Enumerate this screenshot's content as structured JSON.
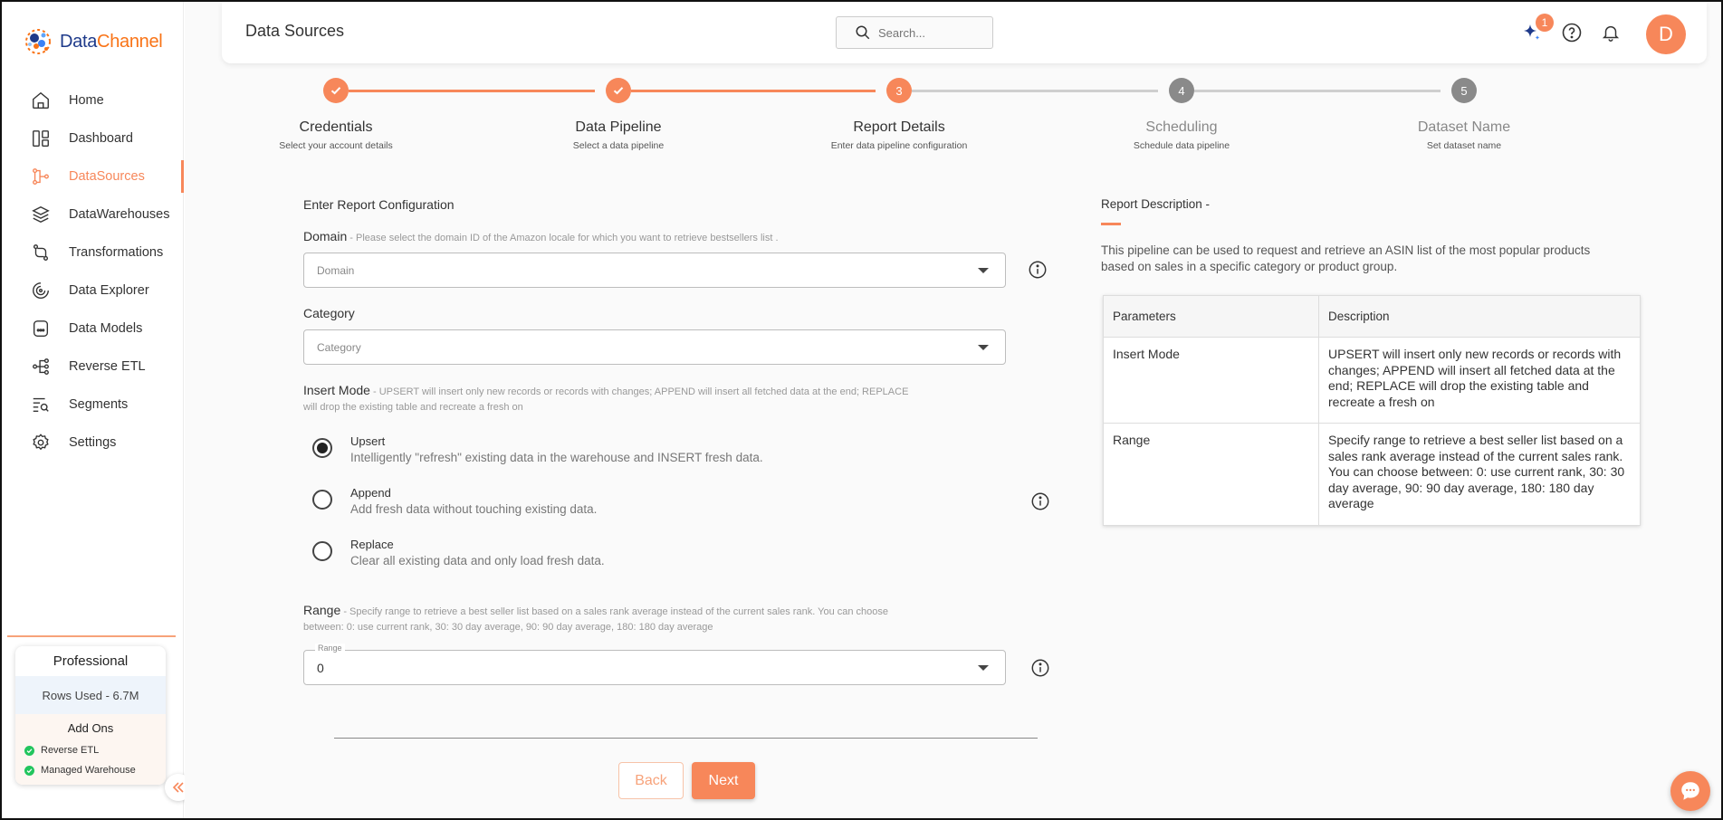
{
  "brand": {
    "name_part1": "Data",
    "name_part2": "Channel"
  },
  "sidebar": {
    "items": [
      {
        "label": "Home",
        "icon": "home-icon",
        "active": false
      },
      {
        "label": "Dashboard",
        "icon": "dashboard-icon",
        "active": false
      },
      {
        "label": "DataSources",
        "icon": "datasources-icon",
        "active": true
      },
      {
        "label": "DataWarehouses",
        "icon": "datawarehouses-icon",
        "active": false
      },
      {
        "label": "Transformations",
        "icon": "transformations-icon",
        "active": false
      },
      {
        "label": "Data Explorer",
        "icon": "data-explorer-icon",
        "active": false
      },
      {
        "label": "Data Models",
        "icon": "data-models-icon",
        "active": false
      },
      {
        "label": "Reverse ETL",
        "icon": "reverse-etl-icon",
        "active": false
      },
      {
        "label": "Segments",
        "icon": "segments-icon",
        "active": false
      },
      {
        "label": "Settings",
        "icon": "settings-icon",
        "active": false
      }
    ],
    "plan": {
      "name": "Professional",
      "rows_used": "Rows Used - 6.7M",
      "addons_title": "Add Ons",
      "addons": [
        "Reverse ETL",
        "Managed Warehouse"
      ]
    },
    "collapse_icon": "double-chevron-left-icon"
  },
  "header": {
    "title": "Data Sources",
    "search_placeholder": "Search...",
    "notification_badge": "1",
    "avatar_letter": "D"
  },
  "stepper": {
    "steps": [
      {
        "title": "Credentials",
        "subtitle": "Select your account details",
        "status": "done",
        "marker": ""
      },
      {
        "title": "Data Pipeline",
        "subtitle": "Select a data pipeline",
        "status": "done",
        "marker": ""
      },
      {
        "title": "Report Details",
        "subtitle": "Enter data pipeline configuration",
        "status": "current",
        "marker": "3"
      },
      {
        "title": "Scheduling",
        "subtitle": "Schedule data pipeline",
        "status": "todo",
        "marker": "4"
      },
      {
        "title": "Dataset Name",
        "subtitle": "Set dataset name",
        "status": "todo",
        "marker": "5"
      }
    ]
  },
  "form": {
    "heading": "Enter Report Configuration",
    "domain": {
      "label": "Domain",
      "help": " - Please select the domain ID of the Amazon locale for which you want to retrieve bestsellers list .",
      "placeholder": "Domain"
    },
    "category": {
      "label": "Category",
      "placeholder": "Category"
    },
    "insert_mode": {
      "label": "Insert Mode",
      "help_line1": " - UPSERT will insert only new records or records with changes; APPEND will insert all fetched data at the end; REPLACE",
      "help_line2": "will drop the existing table and recreate a fresh on",
      "selected": "Upsert",
      "options": [
        {
          "title": "Upsert",
          "desc": "Intelligently \"refresh\" existing data in the warehouse and INSERT fresh data."
        },
        {
          "title": "Append",
          "desc": "Add fresh data without touching existing data."
        },
        {
          "title": "Replace",
          "desc": "Clear all existing data and only load fresh data."
        }
      ]
    },
    "range": {
      "label": "Range",
      "help_line1": " - Specify range to retrieve a best seller list based on a sales rank average instead of the current sales rank. You can choose",
      "help_line2": "between: 0: use current rank, 30: 30 day average, 90: 90 day average, 180: 180 day average",
      "float_label": "Range",
      "value": "0"
    },
    "back_label": "Back",
    "next_label": "Next"
  },
  "description": {
    "title": "Report Description -",
    "text": "This pipeline can be used to request and retrieve an ASIN list of the most popular products based on sales in a specific category or product group.",
    "table": {
      "headers": [
        "Parameters",
        "Description"
      ],
      "rows": [
        [
          "Insert Mode",
          "UPSERT will insert only new records or records with changes; APPEND will insert all fetched data at the end; REPLACE will drop the existing table and recreate a fresh on"
        ],
        [
          "Range",
          "Specify range to retrieve a best seller list based on a sales rank average instead of the current sales rank. You can choose between: 0: use current rank, 30: 30 day average, 90: 90 day average, 180: 180 day average"
        ]
      ]
    }
  },
  "colors": {
    "accent": "#f7875a",
    "brand_blue": "#1e3a8a",
    "success": "#22c55e"
  }
}
